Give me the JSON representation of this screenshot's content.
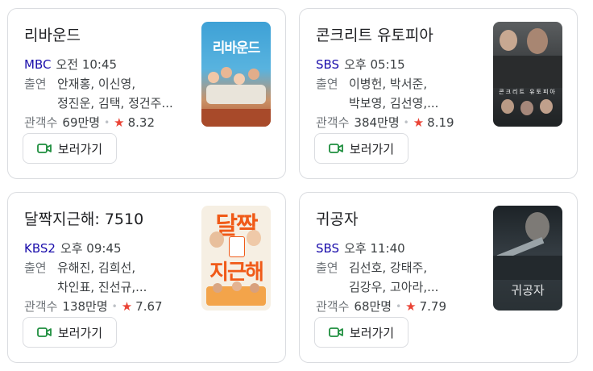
{
  "cards": [
    {
      "title": "리바운드",
      "channel": "MBC",
      "time": "오전 10:45",
      "cast_label": "출연",
      "cast_line1": "안재홍, 이신영,",
      "cast_line2": "정진운, 김택, 정건주...",
      "viewers_label": "관객수",
      "viewers": "69만명",
      "rating": "8.32",
      "button": "보러가기",
      "poster_text": "리바운드"
    },
    {
      "title": "콘크리트 유토피아",
      "channel": "SBS",
      "time": "오후 05:15",
      "cast_label": "출연",
      "cast_line1": "이병헌, 박서준,",
      "cast_line2": "박보영, 김선영,...",
      "viewers_label": "관객수",
      "viewers": "384만명",
      "rating": "8.19",
      "button": "보러가기",
      "poster_text": "콘크리트 유토피아"
    },
    {
      "title": "달짝지근해: 7510",
      "channel": "KBS2",
      "time": "오후 09:45",
      "cast_label": "출연",
      "cast_line1": "유해진, 김희선,",
      "cast_line2": "차인표, 진선규,...",
      "viewers_label": "관객수",
      "viewers": "138만명",
      "rating": "7.67",
      "button": "보러가기",
      "poster_text_top": "달짝",
      "poster_text_bottom": "지근해"
    },
    {
      "title": "귀공자",
      "channel": "SBS",
      "time": "오후 11:40",
      "cast_label": "출연",
      "cast_line1": "김선호, 강태주,",
      "cast_line2": "김강우, 고아라,...",
      "viewers_label": "관객수",
      "viewers": "68만명",
      "rating": "7.79",
      "button": "보러가기",
      "poster_text": "귀공자"
    }
  ],
  "icons": {
    "play": "video-camera-icon",
    "star": "star-icon"
  },
  "colors": {
    "channel": "#1a0dab",
    "star": "#ea4335",
    "video_icon": "#1e8e3e"
  }
}
